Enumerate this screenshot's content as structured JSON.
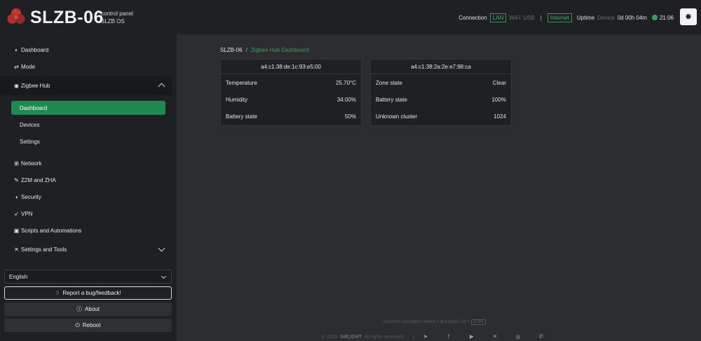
{
  "header": {
    "brand": "SLZB-06",
    "sub_line1": "control panel",
    "sub_line2": "SLZB OS",
    "connection_label": "Connection",
    "lan_badge": "LAN",
    "wifi": "WiFi",
    "usb": "USB",
    "separator": "|",
    "internet_badge": "Internet",
    "uptime_label": "Uptime",
    "device_label": "Device",
    "uptime_value": "0d 00h 04m",
    "time": "21:06",
    "colors": {
      "accent": "#2ea35f",
      "topbar": "#1f2023"
    }
  },
  "sidebar": {
    "items": [
      {
        "label": "Dashboard",
        "icon": "gauge-icon"
      },
      {
        "label": "Mode",
        "icon": "arrows-exchange-icon"
      },
      {
        "label": "Zigbee Hub",
        "icon": "zigbee-icon"
      },
      {
        "label": "Network",
        "icon": "network-icon"
      },
      {
        "label": "Z2M and ZHA",
        "icon": "plug-icon"
      },
      {
        "label": "Security",
        "icon": "shield-icon"
      },
      {
        "label": "VPN",
        "icon": "rocket-icon"
      },
      {
        "label": "Scripts and Automations",
        "icon": "terminal-icon"
      },
      {
        "label": "Settings and Tools",
        "icon": "tools-icon"
      }
    ],
    "zigbee_sub": [
      {
        "label": "Dashboard",
        "active": true
      },
      {
        "label": "Devices",
        "active": false
      },
      {
        "label": "Settings",
        "active": false
      }
    ],
    "language": "English",
    "report_button": "Report a bug/feedback!",
    "about_button": "About",
    "reboot_button": "Reboot"
  },
  "breadcrumb": {
    "root": "SLZB-06",
    "slash": "/",
    "current": "Zigbee Hub Dashboard"
  },
  "cards": [
    {
      "title": "a4:c1:38:de:1c:93:e5:00",
      "rows": [
        {
          "label": "Temperature",
          "value": "25.70°C"
        },
        {
          "label": "Humidity",
          "value": "34.00%"
        },
        {
          "label": "Battery state",
          "value": "50%"
        }
      ]
    },
    {
      "title": "a4:c1:38:2a:2e:e7:98:ca",
      "rows": [
        {
          "label": "Zone state",
          "value": "Clear"
        },
        {
          "label": "Battery state",
          "value": "100%"
        },
        {
          "label": "Unknown cluster",
          "value": "1024"
        }
      ]
    }
  ],
  "footer": {
    "hint": "Incorrect translation? Select it and press Ctrl +",
    "hint_key": "Enter",
    "copyright_prefix": "© 2025",
    "company": "SMLIGHT",
    "copyright_suffix": "All rights reserved.",
    "pipe": "|",
    "social_icons": [
      "telegram-icon",
      "facebook-icon",
      "youtube-icon",
      "x-icon",
      "instagram-icon",
      "whatsapp-icon"
    ]
  }
}
